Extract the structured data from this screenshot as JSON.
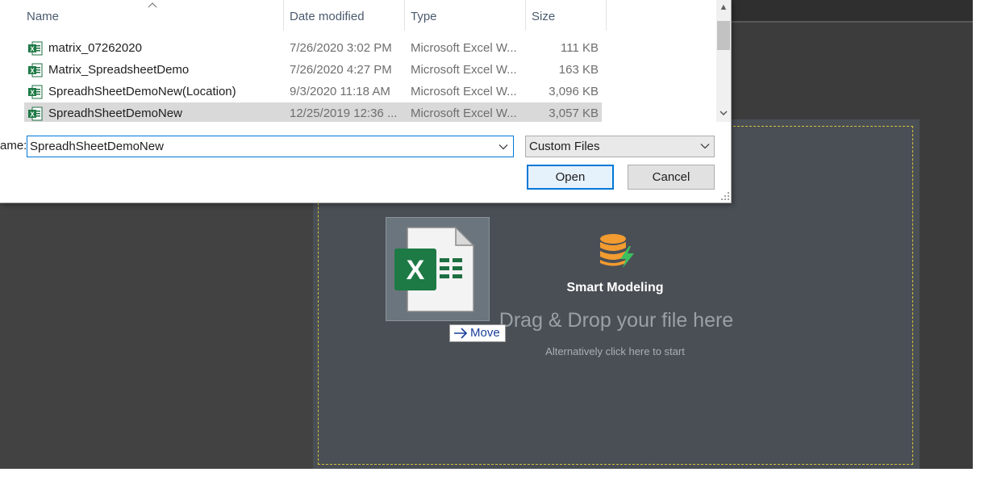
{
  "dialog": {
    "columns": {
      "name": "Name",
      "date": "Date modified",
      "type": "Type",
      "size": "Size"
    },
    "files": [
      {
        "name": "matrix_07262020",
        "date": "7/26/2020 3:02 PM",
        "type": "Microsoft Excel W...",
        "size": "111 KB",
        "selected": false
      },
      {
        "name": "Matrix_SpreadsheetDemo",
        "date": "7/26/2020 4:27 PM",
        "type": "Microsoft Excel W...",
        "size": "163 KB",
        "selected": false
      },
      {
        "name": "SpreadhSheetDemoNew(Location)",
        "date": "9/3/2020 11:18 AM",
        "type": "Microsoft Excel W...",
        "size": "3,096 KB",
        "selected": false
      },
      {
        "name": "SpreadhSheetDemoNew",
        "date": "12/25/2019 12:36 ...",
        "type": "Microsoft Excel W...",
        "size": "3,057 KB",
        "selected": true
      }
    ],
    "file_name_label": "ame:",
    "file_name_value": "SpreadhSheetDemoNew",
    "file_type_selected": "Custom Files",
    "open_label": "Open",
    "cancel_label": "Cancel"
  },
  "dropzone": {
    "brand": "Smart Modeling",
    "heading": "Drag & Drop your file here",
    "subtext": "Alternatively click here to start",
    "drag_hint": "Move"
  },
  "colors": {
    "accent": "#0078d7",
    "excel_green": "#1d6f42",
    "brand_orange": "#f29b30",
    "brand_green": "#3bbf5f",
    "drop_border": "#d4c23a"
  },
  "icons": {
    "file": "excel-file-icon",
    "brand": "database-bolt-icon",
    "drag": "excel-document-icon",
    "move": "arrow-right-icon"
  }
}
